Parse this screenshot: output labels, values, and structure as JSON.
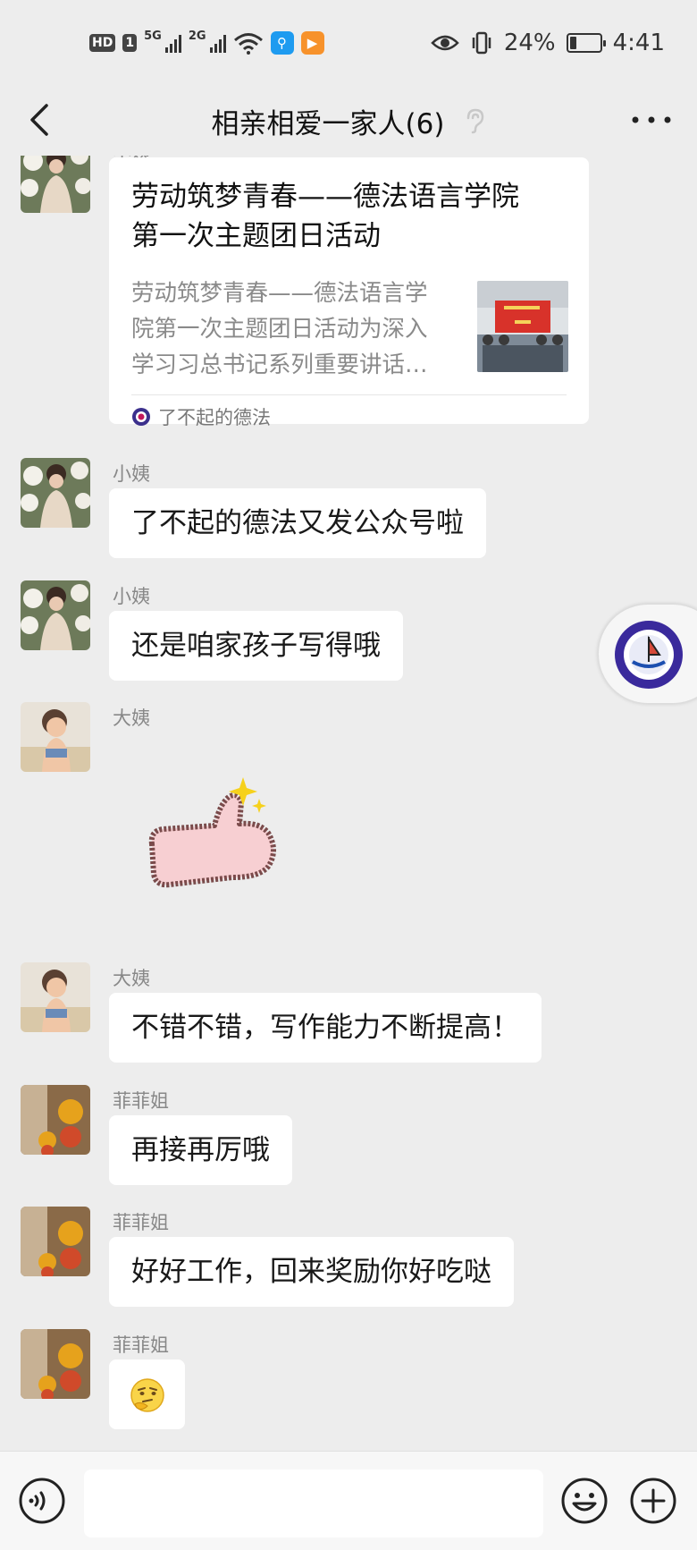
{
  "status_bar": {
    "hd": "HD",
    "sim": "1",
    "net_a": "5G",
    "net_b": "2G",
    "battery_percent": "24%",
    "battery_level": 0.24,
    "time": "4:41"
  },
  "header": {
    "title": "相亲相爱一家人(6)"
  },
  "messages": [
    {
      "sender": "小姨",
      "type": "article",
      "title_line1": "劳动筑梦青春——德法语言学院",
      "title_line2": "第一次主题团日活动",
      "desc_line1": "劳动筑梦青春——德法语言学",
      "desc_line2": "院第一次主题团日活动为深入",
      "desc_line3": "学习习总书记系列重要讲话…",
      "source": "了不起的德法"
    },
    {
      "sender": "小姨",
      "type": "text",
      "text": "了不起的德法又发公众号啦"
    },
    {
      "sender": "小姨",
      "type": "text",
      "text": "还是咱家孩子写得哦"
    },
    {
      "sender": "大姨",
      "type": "sticker",
      "sticker": "thumbs-up-sticker"
    },
    {
      "sender": "大姨",
      "type": "text",
      "text": "不错不错，写作能力不断提高！"
    },
    {
      "sender": "菲菲姐",
      "type": "text",
      "text": "再接再厉哦"
    },
    {
      "sender": "菲菲姐",
      "type": "text",
      "text": "好好工作，回来奖励你好吃哒"
    },
    {
      "sender": "菲菲姐",
      "type": "emoji",
      "emoji": "thinking-face-icon"
    }
  ],
  "input": {
    "value": "",
    "placeholder": ""
  },
  "colors": {
    "background": "#ededed",
    "bubble": "#ffffff",
    "sender_text": "#888888"
  }
}
